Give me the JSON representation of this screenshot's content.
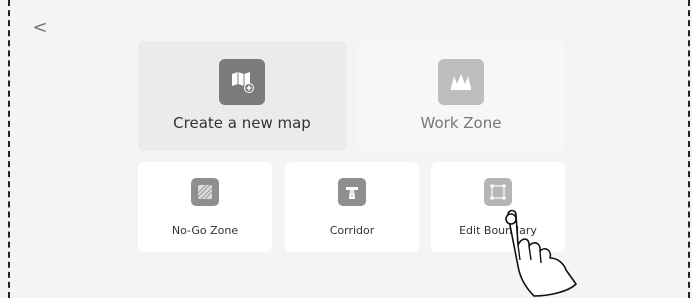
{
  "back": {
    "glyph": "<"
  },
  "cards": {
    "create_map": {
      "label": "Create a new map",
      "icon": "map-add-icon"
    },
    "work_zone": {
      "label": "Work Zone",
      "icon": "grass-icon"
    },
    "no_go_zone": {
      "label": "No-Go Zone",
      "icon": "hatched-square-icon"
    },
    "corridor": {
      "label": "Corridor",
      "icon": "road-icon"
    },
    "edit_boundary": {
      "label": "Edit Boundary",
      "icon": "edit-boundary-icon"
    }
  },
  "colors": {
    "background": "#f4f4f4",
    "card": "#ffffff",
    "card_selected": "#ebebeb",
    "icon_dark": "#7b7b7b",
    "icon_light": "#bdbdbd"
  }
}
